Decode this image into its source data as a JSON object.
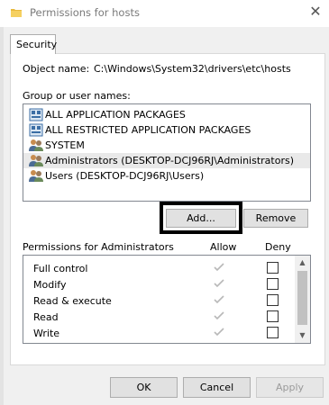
{
  "window": {
    "title": "Permissions for hosts",
    "close_glyph": "✕"
  },
  "tabs": [
    {
      "label": "Security",
      "active": true
    }
  ],
  "object": {
    "label": "Object name:",
    "value": "C:\\Windows\\System32\\drivers\\etc\\hosts"
  },
  "groups": {
    "label": "Group or user names:",
    "items": [
      {
        "label": "ALL APPLICATION PACKAGES",
        "icon": "package-group-icon",
        "selected": false
      },
      {
        "label": "ALL RESTRICTED APPLICATION PACKAGES",
        "icon": "package-group-icon",
        "selected": false
      },
      {
        "label": "SYSTEM",
        "icon": "users-group-icon",
        "selected": false
      },
      {
        "label": "Administrators (DESKTOP-DCJ96RJ\\Administrators)",
        "icon": "users-group-icon",
        "selected": true
      },
      {
        "label": "Users (DESKTOP-DCJ96RJ\\Users)",
        "icon": "users-group-icon",
        "selected": false
      }
    ]
  },
  "buttons": {
    "add": "Add...",
    "remove": "Remove",
    "ok": "OK",
    "cancel": "Cancel",
    "apply": "Apply"
  },
  "permissions": {
    "header": "Permissions for Administrators",
    "allow_header": "Allow",
    "deny_header": "Deny",
    "rows": [
      {
        "name": "Full control",
        "allow": true,
        "deny": false
      },
      {
        "name": "Modify",
        "allow": true,
        "deny": false
      },
      {
        "name": "Read & execute",
        "allow": true,
        "deny": false
      },
      {
        "name": "Read",
        "allow": true,
        "deny": false
      },
      {
        "name": "Write",
        "allow": true,
        "deny": false
      }
    ]
  },
  "colors": {
    "selected_row": "#e9e9e9",
    "disabled_text": "#9a9a9a",
    "highlight": "#000000"
  }
}
